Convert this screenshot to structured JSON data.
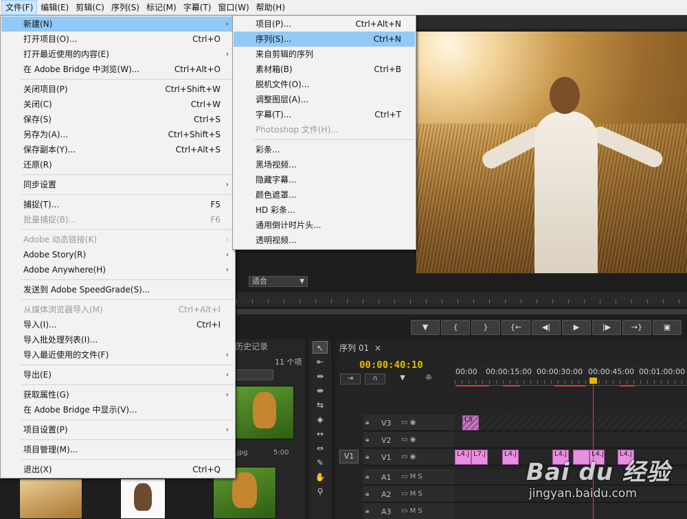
{
  "menubar": {
    "items": [
      "文件(F)",
      "编辑(E)",
      "剪辑(C)",
      "序列(S)",
      "标记(M)",
      "字幕(T)",
      "窗口(W)",
      "帮助(H)"
    ]
  },
  "file_menu": {
    "items": [
      {
        "label": "新建(N)",
        "shortcut": "",
        "submenu": true,
        "highlighted": true
      },
      {
        "label": "打开项目(O)...",
        "shortcut": "Ctrl+O"
      },
      {
        "label": "打开最近使用的内容(E)",
        "shortcut": "",
        "submenu": true
      },
      {
        "label": "在 Adobe Bridge 中浏览(W)...",
        "shortcut": "Ctrl+Alt+O"
      },
      {
        "label": "关闭项目(P)",
        "shortcut": "Ctrl+Shift+W"
      },
      {
        "label": "关闭(C)",
        "shortcut": "Ctrl+W"
      },
      {
        "label": "保存(S)",
        "shortcut": "Ctrl+S"
      },
      {
        "label": "另存为(A)...",
        "shortcut": "Ctrl+Shift+S"
      },
      {
        "label": "保存副本(Y)...",
        "shortcut": "Ctrl+Alt+S"
      },
      {
        "label": "还原(R)",
        "shortcut": ""
      },
      {
        "label": "同步设置",
        "shortcut": "",
        "submenu": true
      },
      {
        "label": "捕捉(T)...",
        "shortcut": "F5"
      },
      {
        "label": "批量捕捉(B)...",
        "shortcut": "F6",
        "disabled": true
      },
      {
        "label": "Adobe 动态链接(K)",
        "shortcut": "",
        "submenu": true,
        "disabled": true
      },
      {
        "label": "Adobe Story(R)",
        "shortcut": "",
        "submenu": true
      },
      {
        "label": "Adobe Anywhere(H)",
        "shortcut": "",
        "submenu": true
      },
      {
        "label": "发送到 Adobe SpeedGrade(S)...",
        "shortcut": ""
      },
      {
        "label": "从媒体浏览器导入(M)",
        "shortcut": "Ctrl+Alt+I",
        "disabled": true
      },
      {
        "label": "导入(I)...",
        "shortcut": "Ctrl+I"
      },
      {
        "label": "导入批处理列表(I)...",
        "shortcut": ""
      },
      {
        "label": "导入最近使用的文件(F)",
        "shortcut": "",
        "submenu": true
      },
      {
        "label": "导出(E)",
        "shortcut": "",
        "submenu": true
      },
      {
        "label": "获取属性(G)",
        "shortcut": "",
        "submenu": true
      },
      {
        "label": "在 Adobe Bridge 中显示(V)...",
        "shortcut": ""
      },
      {
        "label": "项目设置(P)",
        "shortcut": "",
        "submenu": true
      },
      {
        "label": "项目管理(M)...",
        "shortcut": ""
      },
      {
        "label": "退出(X)",
        "shortcut": "Ctrl+Q"
      }
    ]
  },
  "new_submenu": {
    "items": [
      {
        "label": "项目(P)...",
        "shortcut": "Ctrl+Alt+N"
      },
      {
        "label": "序列(S)...",
        "shortcut": "Ctrl+N",
        "highlighted": true
      },
      {
        "label": "来自剪辑的序列",
        "shortcut": ""
      },
      {
        "label": "素材箱(B)",
        "shortcut": "Ctrl+B"
      },
      {
        "label": "脱机文件(O)...",
        "shortcut": ""
      },
      {
        "label": "调整图层(A)...",
        "shortcut": ""
      },
      {
        "label": "字幕(T)...",
        "shortcut": "Ctrl+T"
      },
      {
        "label": "Photoshop 文件(H)...",
        "shortcut": "",
        "disabled": true
      },
      {
        "label": "彩条...",
        "shortcut": ""
      },
      {
        "label": "黑场视频...",
        "shortcut": ""
      },
      {
        "label": "隐藏字幕...",
        "shortcut": ""
      },
      {
        "label": "颜色遮罩...",
        "shortcut": ""
      },
      {
        "label": "HD 彩条...",
        "shortcut": ""
      },
      {
        "label": "通用倒计时片头...",
        "shortcut": ""
      },
      {
        "label": "透明视频...",
        "shortcut": ""
      }
    ]
  },
  "monitor": {
    "fit_label": "适合",
    "transport": [
      "▼",
      "{",
      "}",
      "{←",
      "◀|",
      "▶",
      "|▶",
      "→}"
    ]
  },
  "project_panel": {
    "tab": "历史记录",
    "count": "11 个项",
    "thumb_label_1": ".jpg",
    "thumb_label_2": "5:00"
  },
  "timeline": {
    "tab": "序列 01",
    "close": "×",
    "timecode": "00:00:40:10",
    "ruler_times": [
      "00:00",
      "00:00:15:00",
      "00:00:30:00",
      "00:00:45:00",
      "00:01:00:00"
    ],
    "source_patch": "V1",
    "tracks": [
      {
        "name": "V3",
        "toggles": "▭ ◉"
      },
      {
        "name": "V2",
        "toggles": "▭ ◉"
      },
      {
        "name": "V1",
        "toggles": "▭ ◉"
      },
      {
        "name": "A1",
        "toggles": "▭ M S"
      },
      {
        "name": "A2",
        "toggles": "▭ M S"
      },
      {
        "name": "A3",
        "toggles": "▭ M S"
      }
    ],
    "clips_v3": [
      "L5"
    ],
    "clips_v1": [
      "L4.j",
      "L7.j",
      "L4.j",
      "L4.j",
      "",
      "L4.j",
      "L4.j"
    ]
  },
  "watermark": {
    "line1": "Bai du 经验",
    "line2": "jingyan.baidu.com"
  }
}
